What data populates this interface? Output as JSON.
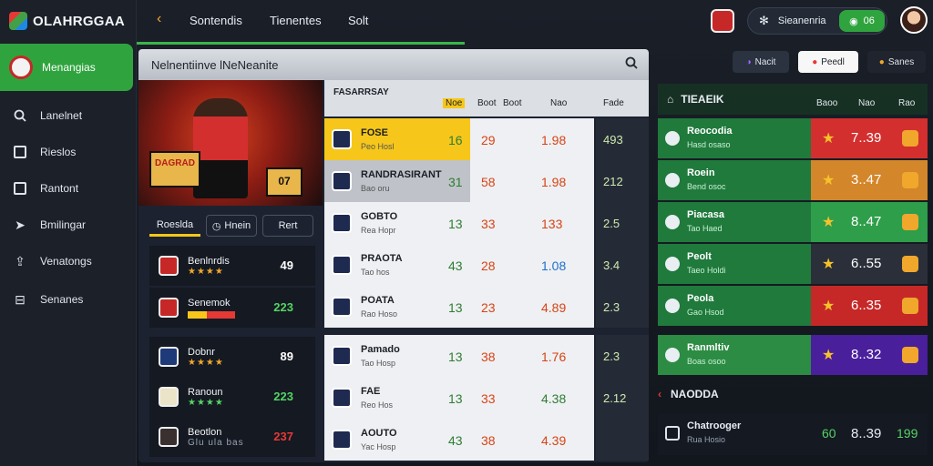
{
  "app": {
    "title": "OLAHRGGAA"
  },
  "sidebar": {
    "active": {
      "label": "Menangias"
    },
    "items": [
      {
        "label": "Lanelnet",
        "icon": "search-icon"
      },
      {
        "label": "Rieslos",
        "icon": "square-icon"
      },
      {
        "label": "Rantont",
        "icon": "square-icon"
      },
      {
        "label": "Bmilingar",
        "icon": "arrow-icon"
      },
      {
        "label": "Venatongs",
        "icon": "export-icon"
      },
      {
        "label": "Senanes",
        "icon": "grid-icon"
      }
    ]
  },
  "topbar": {
    "nav": [
      "Sontendis",
      "Tienentes",
      "Solt"
    ],
    "user": {
      "name": "Sieanenria",
      "toggle": "06"
    }
  },
  "center": {
    "header": "Nelnentiinve lNeNeanite",
    "hero": {
      "sign": "DAGRAD",
      "sign2": "07"
    },
    "tabs": [
      "Roeslda",
      "Hnein",
      "Rert"
    ],
    "left_cards": [
      {
        "name": "Benlnrdis",
        "stars": "★★★★",
        "score": "49",
        "score_color": "#ffffff"
      },
      {
        "name": "Senemok",
        "stars": "",
        "score": "223",
        "score_color": "#56d364"
      },
      {
        "name": "Dobnr",
        "stars": "★★★★",
        "score": "89",
        "score_color": "#ffffff"
      },
      {
        "name": "Ranoun",
        "stars": "★★★★",
        "score": "223",
        "score_color": "#56d364"
      },
      {
        "name": "Beotlon",
        "stars": "Glu ula bas",
        "score": "237",
        "score_color": "#e53935"
      }
    ]
  },
  "table": {
    "title": "FASARRSAY",
    "columns": [
      "Noe",
      "Boot",
      "Nao",
      "Fade"
    ],
    "rows": [
      {
        "team": "FOSE",
        "sub": "Peo Hosl",
        "v1": "16",
        "v2": "29",
        "v3": "1.98",
        "v4": "493",
        "hl": "#f6c71a"
      },
      {
        "team": "RANDRASIRANT",
        "sub": "Bao oru",
        "v1": "31",
        "v2": "58",
        "v3": "1.98",
        "v4": "212",
        "hl": "#bfc3c9"
      },
      {
        "team": "GOBTO",
        "sub": "Rea Hopr",
        "v1": "13",
        "v2": "33",
        "v3": "133",
        "v4": "2.5",
        "hl": "#eef0f3"
      },
      {
        "team": "PRAOTA",
        "sub": "Tao hos",
        "v1": "43",
        "v2": "28",
        "v3": "1.08",
        "v4": "3.4",
        "hl": "#eef0f3"
      },
      {
        "team": "POATA",
        "sub": "Rao Hoso",
        "v1": "13",
        "v2": "23",
        "v3": "4.89",
        "v4": "2.3",
        "hl": "#eef0f3"
      },
      {
        "team": "Pamado",
        "sub": "Tao Hosp",
        "v1": "13",
        "v2": "38",
        "v3": "1.76",
        "v4": "2.3",
        "hl": "#eef0f3"
      },
      {
        "team": "FAE",
        "sub": "Reo Hos",
        "v1": "13",
        "v2": "33",
        "v3": "4.38",
        "v4": "2.12",
        "hl": "#eef0f3"
      },
      {
        "team": "AOUTO",
        "sub": "Yac Hosp",
        "v1": "43",
        "v2": "38",
        "v3": "4.39",
        "v4": "",
        "hl": "#eef0f3"
      }
    ]
  },
  "right": {
    "chips": [
      "Nacit",
      "Peedl",
      "Sanes"
    ],
    "header": "TIEAEIK",
    "cols": [
      "Baoo",
      "Nao",
      "Rao"
    ],
    "rows": [
      {
        "name": "Reocodia",
        "sub": "Hasd osaso",
        "val": "7..39",
        "blk": "#d32f2f"
      },
      {
        "name": "Roein",
        "sub": "Bend osoc",
        "val": "3..47",
        "blk": "#d4862a"
      },
      {
        "name": "Piacasa",
        "sub": "Tao Haed",
        "val": "8..47",
        "blk": "#2e9e4a"
      },
      {
        "name": "Peolt",
        "sub": "Taeo Holdi",
        "val": "6..55",
        "blk": "#2a2f3a"
      },
      {
        "name": "Peola",
        "sub": "Gao Hsod",
        "val": "6..35",
        "blk": "#c62828"
      },
      {
        "name": "Ranmltiv",
        "sub": "Boas osoo",
        "val": "8..32",
        "blk": "#4a1f9c"
      }
    ],
    "section2": "NAODDA",
    "bottom": {
      "name": "Chatrooger",
      "sub": "Rua Hosio",
      "a": "60",
      "val": "8..39",
      "b": "199"
    }
  }
}
